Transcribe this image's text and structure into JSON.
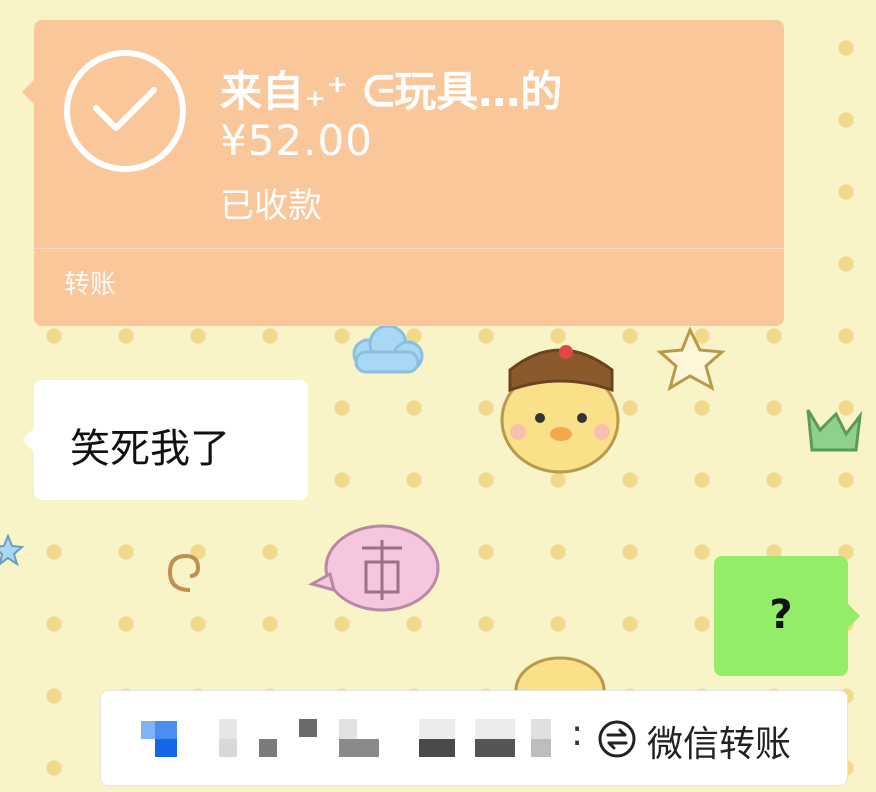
{
  "transfer": {
    "from": "来自₊⁺ ᕮ玩具…的",
    "amount": "¥52.00",
    "status": "已收款",
    "label": "转账"
  },
  "messages": [
    {
      "direction": "incoming",
      "text": "笑死我了"
    },
    {
      "direction": "outgoing",
      "text": "?"
    }
  ],
  "quote": {
    "colon": ":",
    "text": "微信转账",
    "icon": "transfer-arrows-icon"
  },
  "colors": {
    "transfer_card": "#f9c79a",
    "outgoing_bubble": "#95ec69",
    "incoming_bubble": "#ffffff",
    "wallpaper": "#f9f3c8"
  }
}
